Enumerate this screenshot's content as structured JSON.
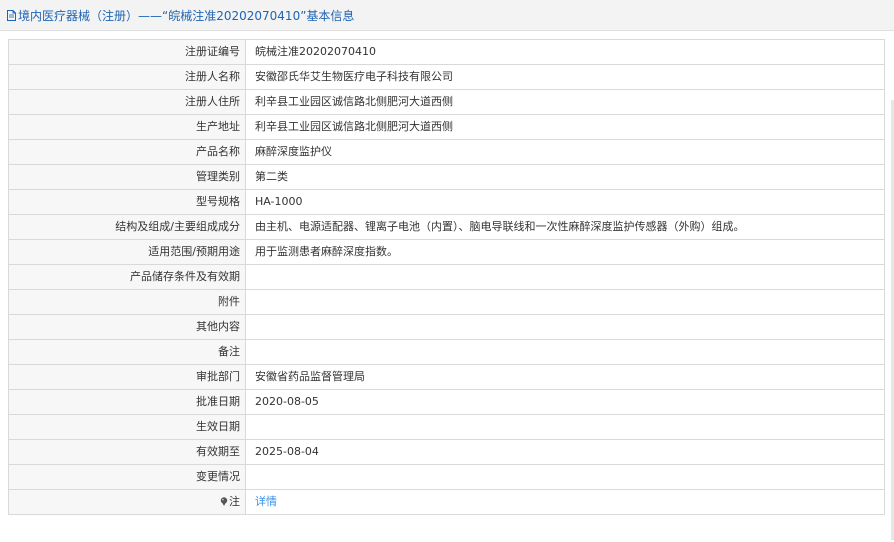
{
  "header": {
    "title": "境内医疗器械（注册）——“皖械注准20202070410”基本信息",
    "icon": "document-icon"
  },
  "rows": [
    {
      "label": "注册证编号",
      "value": "皖械注准20202070410"
    },
    {
      "label": "注册人名称",
      "value": "安徽邵氏华艾生物医疗电子科技有限公司"
    },
    {
      "label": "注册人住所",
      "value": "利辛县工业园区诚信路北侧肥河大道西侧"
    },
    {
      "label": "生产地址",
      "value": "利辛县工业园区诚信路北侧肥河大道西侧"
    },
    {
      "label": "产品名称",
      "value": "麻醉深度监护仪"
    },
    {
      "label": "管理类别",
      "value": "第二类"
    },
    {
      "label": "型号规格",
      "value": "HA-1000"
    },
    {
      "label": "结构及组成/主要组成成分",
      "value": "由主机、电源适配器、锂离子电池（内置）、脑电导联线和一次性麻醉深度监护传感器（外购）组成。"
    },
    {
      "label": "适用范围/预期用途",
      "value": "用于监测患者麻醉深度指数。"
    },
    {
      "label": "产品储存条件及有效期",
      "value": ""
    },
    {
      "label": "附件",
      "value": ""
    },
    {
      "label": "其他内容",
      "value": ""
    },
    {
      "label": "备注",
      "value": ""
    },
    {
      "label": "审批部门",
      "value": "安徽省药品监督管理局"
    },
    {
      "label": "批准日期",
      "value": "2020-08-05"
    },
    {
      "label": "生效日期",
      "value": ""
    },
    {
      "label": "有效期至",
      "value": "2025-08-04"
    },
    {
      "label": "变更情况",
      "value": ""
    }
  ],
  "note_row": {
    "label": "注",
    "link_text": "详情",
    "icon": "pin-icon"
  },
  "colors": {
    "title_text": "#1e64b4",
    "link": "#3a8ee6",
    "label_bg": "#f7f7f7",
    "border": "#d9d9d9"
  }
}
